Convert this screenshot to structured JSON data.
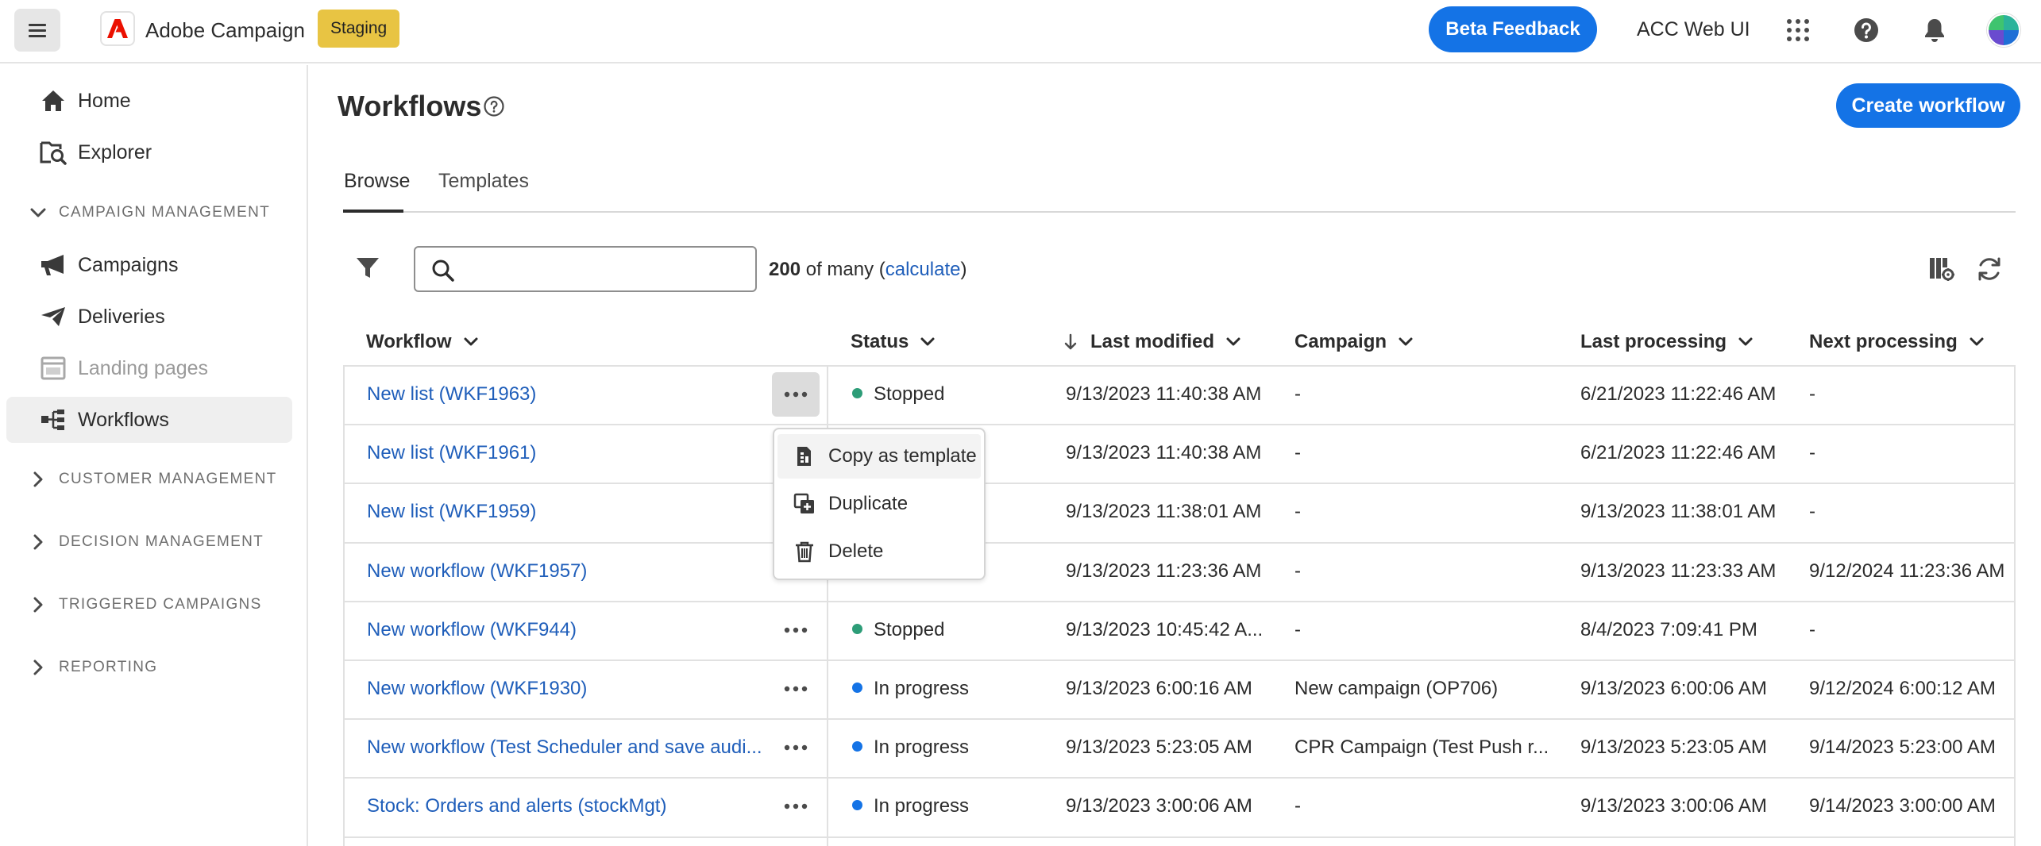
{
  "header": {
    "app_title": "Adobe Campaign",
    "env_badge": "Staging",
    "beta_button": "Beta Feedback",
    "org_name": "ACC Web UI"
  },
  "sidebar": {
    "items": [
      {
        "label": "Home",
        "icon": "home-icon"
      },
      {
        "label": "Explorer",
        "icon": "explorer-icon"
      },
      {
        "label": "Campaigns",
        "icon": "megaphone-icon"
      },
      {
        "label": "Deliveries",
        "icon": "paper-plane-icon"
      },
      {
        "label": "Landing pages",
        "icon": "landing-page-icon"
      },
      {
        "label": "Workflows",
        "icon": "workflow-icon"
      }
    ],
    "sections": [
      {
        "label": "CAMPAIGN MANAGEMENT",
        "expanded": true
      },
      {
        "label": "CUSTOMER MANAGEMENT",
        "expanded": false
      },
      {
        "label": "DECISION MANAGEMENT",
        "expanded": false
      },
      {
        "label": "TRIGGERED CAMPAIGNS",
        "expanded": false
      },
      {
        "label": "REPORTING",
        "expanded": false
      }
    ]
  },
  "page": {
    "title": "Workflows",
    "create_button": "Create workflow",
    "tabs": [
      {
        "label": "Browse"
      },
      {
        "label": "Templates"
      }
    ]
  },
  "toolbar": {
    "search_placeholder": "",
    "count_number": "200",
    "count_text": " of many (",
    "count_link": "calculate",
    "count_close": ")"
  },
  "table": {
    "columns": [
      "Workflow",
      "Status",
      "Last modified",
      "Campaign",
      "Last processing",
      "Next processing"
    ],
    "rows": [
      {
        "workflow": "New list (WKF1963)",
        "status": "Stopped",
        "status_color": "#2d9d78",
        "last_modified": "9/13/2023 11:40:38 AM",
        "campaign": "-",
        "last_processing": "6/21/2023 11:22:46 AM",
        "next_processing": "-"
      },
      {
        "workflow": "New list (WKF1961)",
        "status": "",
        "status_color": "",
        "last_modified": "9/13/2023 11:40:38 AM",
        "campaign": "-",
        "last_processing": "6/21/2023 11:22:46 AM",
        "next_processing": "-"
      },
      {
        "workflow": "New list (WKF1959)",
        "status": "",
        "status_color": "",
        "last_modified": "9/13/2023 11:38:01 AM",
        "campaign": "-",
        "last_processing": "9/13/2023 11:38:01 AM",
        "next_processing": "-"
      },
      {
        "workflow": "New workflow (WKF1957)",
        "status": "",
        "status_color": "",
        "last_modified": "9/13/2023 11:23:36 AM",
        "campaign": "-",
        "last_processing": "9/13/2023 11:23:33 AM",
        "next_processing": "9/12/2024 11:23:36 AM"
      },
      {
        "workflow": "New workflow (WKF944)",
        "status": "Stopped",
        "status_color": "#2d9d78",
        "last_modified": "9/13/2023 10:45:42 A...",
        "campaign": "-",
        "last_processing": "8/4/2023 7:09:41 PM",
        "next_processing": "-"
      },
      {
        "workflow": "New workflow (WKF1930)",
        "status": "In progress",
        "status_color": "#1473e6",
        "last_modified": "9/13/2023 6:00:16 AM",
        "campaign": "New campaign (OP706)",
        "last_processing": "9/13/2023 6:00:06 AM",
        "next_processing": "9/12/2024 6:00:12 AM"
      },
      {
        "workflow": "New workflow (Test Scheduler and save audi...",
        "status": "In progress",
        "status_color": "#1473e6",
        "last_modified": "9/13/2023 5:23:05 AM",
        "campaign": "CPR Campaign (Test Push r...",
        "last_processing": "9/13/2023 5:23:05 AM",
        "next_processing": "9/14/2023 5:23:00 AM"
      },
      {
        "workflow": "Stock: Orders and alerts (stockMgt)",
        "status": "In progress",
        "status_color": "#1473e6",
        "last_modified": "9/13/2023 3:00:06 AM",
        "campaign": "-",
        "last_processing": "9/13/2023 3:00:06 AM",
        "next_processing": "9/14/2023 3:00:00 AM"
      }
    ]
  },
  "context_menu": {
    "items": [
      {
        "label": "Copy as template",
        "icon": "copy-template-icon"
      },
      {
        "label": "Duplicate",
        "icon": "duplicate-icon"
      },
      {
        "label": "Delete",
        "icon": "trash-icon"
      }
    ]
  },
  "colors": {
    "accent": "#1473e6",
    "link": "#1f5eba",
    "badge": "#e8c443",
    "brand_red": "#eb1000"
  }
}
